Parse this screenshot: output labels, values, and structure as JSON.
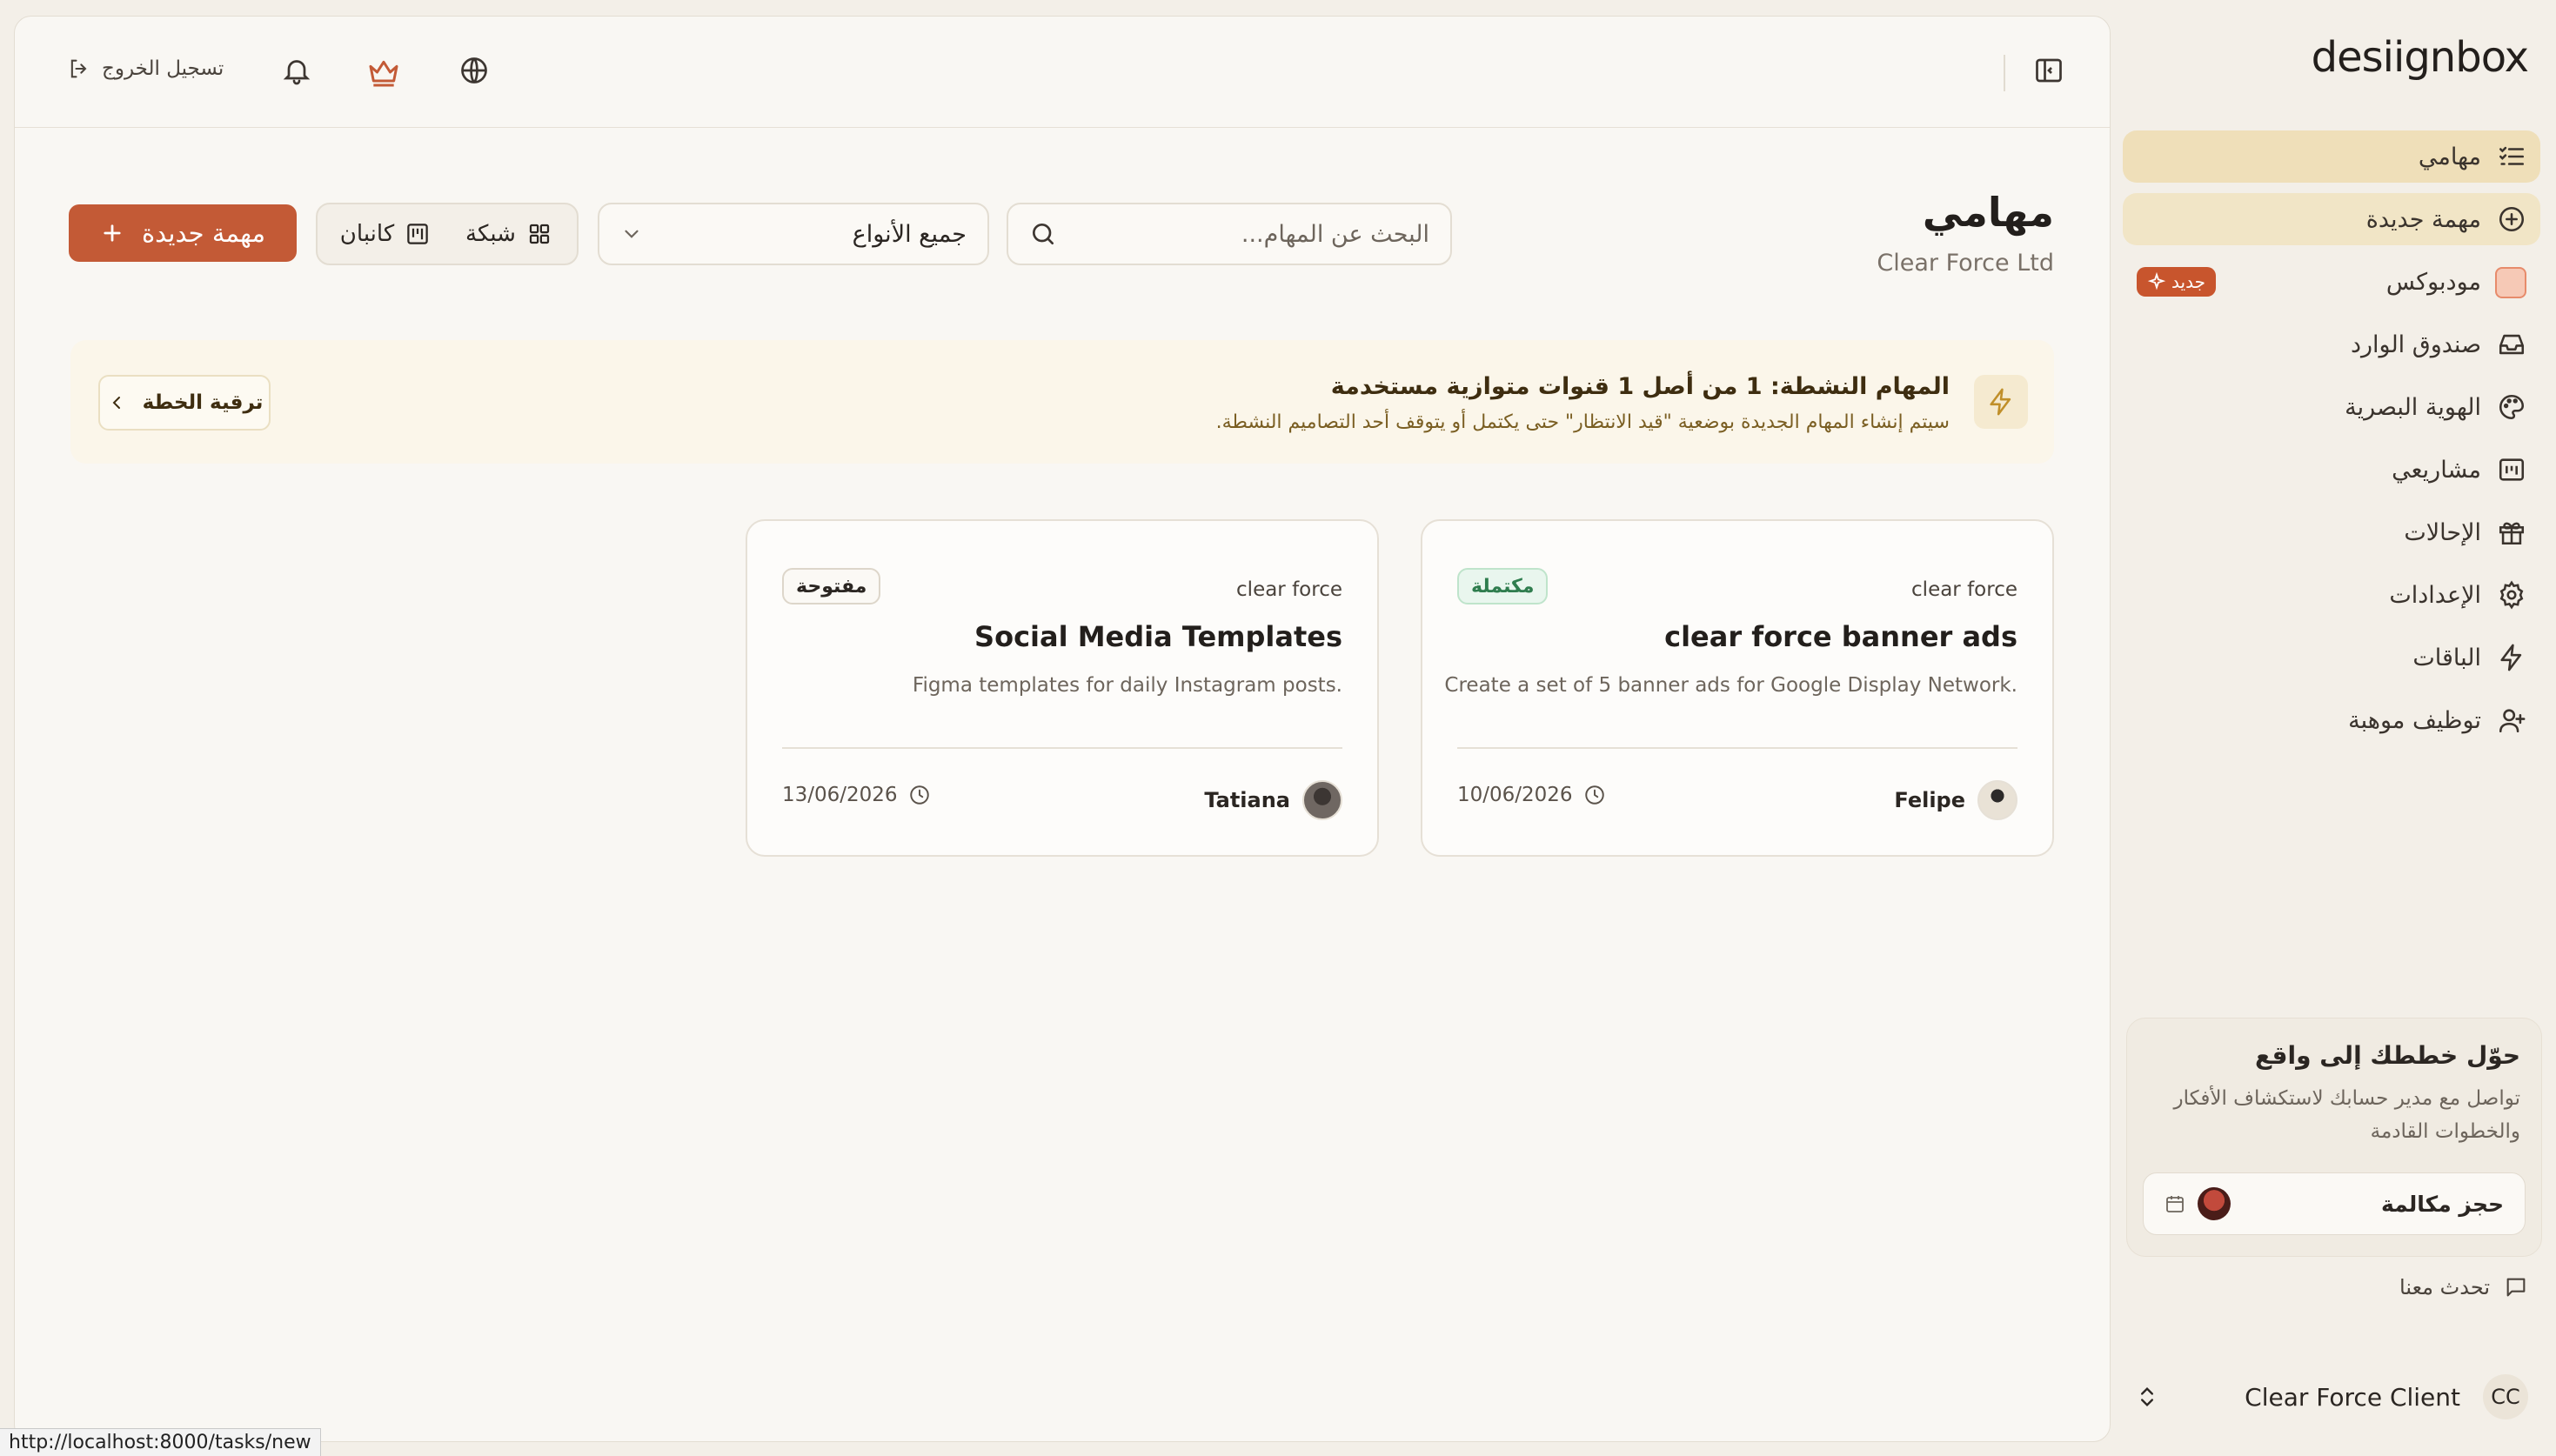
{
  "brand": {
    "logo": "desiignbox"
  },
  "sidebar": {
    "items": [
      {
        "label": "مهامي",
        "icon": "tasks-list-icon",
        "state": "active"
      },
      {
        "label": "مهمة جديدة",
        "icon": "plus-circle-icon",
        "state": "highlight"
      },
      {
        "label": "مودبوكس",
        "icon": "moodbox-icon",
        "badge": "جديد"
      },
      {
        "label": "صندوق الوارد",
        "icon": "inbox-icon"
      },
      {
        "label": "الهوية البصرية",
        "icon": "palette-icon"
      },
      {
        "label": "مشاريعي",
        "icon": "projects-icon"
      },
      {
        "label": "الإحالات",
        "icon": "gift-icon"
      },
      {
        "label": "الإعدادات",
        "icon": "gear-icon"
      },
      {
        "label": "الباقات",
        "icon": "lightning-icon"
      },
      {
        "label": "توظيف موهبة",
        "icon": "user-plus-icon"
      }
    ],
    "promo": {
      "title": "حوّل خططك إلى واقع",
      "text": "تواصل مع مدير حسابك لاستكشاف الأفكار والخطوات القادمة",
      "button": "حجز مكالمة"
    },
    "chat": "تحدث معنا",
    "client": {
      "initials": "CC",
      "name": "Clear Force Client"
    }
  },
  "topbar": {
    "logout": "تسجيل الخروج"
  },
  "page": {
    "title": "مهامي",
    "subtitle": "Clear Force Ltd",
    "search_placeholder": "البحث عن المهام...",
    "filter_value": "جميع الأنواع",
    "view_grid": "شبكة",
    "view_kanban": "كانبان",
    "new_task": "مهمة جديدة"
  },
  "notice": {
    "title": "المهام النشطة: 1 من أصل 1 قنوات متوازية مستخدمة",
    "text": "سيتم إنشاء المهام الجديدة بوضعية \"قيد الانتظار\" حتى يكتمل أو يتوقف أحد التصاميم النشطة.",
    "upgrade": "ترقية الخطة"
  },
  "tasks": [
    {
      "client": "clear force",
      "status": "مكتملة",
      "title": "clear force banner ads",
      "description": "Create a set of 5 banner ads for Google Display Network.",
      "assignee": "Felipe",
      "date": "10/06/2026"
    },
    {
      "client": "clear force",
      "status": "مفتوحة",
      "title": "Social Media Templates",
      "description": "Figma templates for daily Instagram posts.",
      "assignee": "Tatiana",
      "date": "13/06/2026"
    }
  ],
  "statusbar": {
    "url": "http://localhost:8000/tasks/new"
  }
}
